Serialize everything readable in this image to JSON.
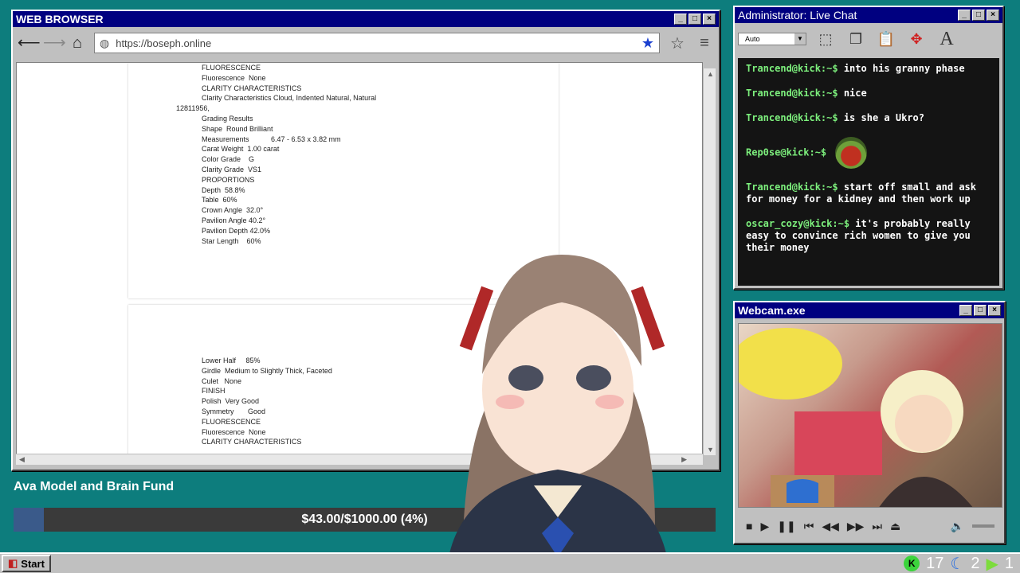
{
  "browser": {
    "title": "WEB BROWSER",
    "url": "https://boseph.online",
    "page1": [
      "FLUORESCENCE",
      "Fluorescence  None",
      "CLARITY CHARACTERISTICS",
      "Clarity Characteristics Cloud, Indented Natural, Natural",
      "12811956,",
      "Grading Results",
      "Shape  Round Brilliant",
      "Measurements           6.47 - 6.53 x 3.82 mm",
      "Carat Weight  1.00 carat",
      "Color Grade    G",
      "Clarity Grade  VS1",
      "PROPORTIONS",
      "Depth  58.8%",
      "Table  60%",
      "Crown Angle  32.0°",
      "Pavilion Angle 40.2°",
      "Pavilion Depth 42.0%",
      "Star Length    60%"
    ],
    "page2": [
      "Lower Half     85%",
      "Girdle  Medium to Slightly Thick, Faceted",
      "Culet   None",
      "FINISH",
      "Polish  Very Good",
      "Symmetry       Good",
      "FLUORESCENCE",
      "Fluorescence  None",
      "CLARITY CHARACTERISTICS"
    ]
  },
  "chat": {
    "title": "Administrator: Live Chat",
    "font_select": "Auto",
    "messages": [
      {
        "user": "Trancend@kick:~$",
        "text": "into his granny phase"
      },
      {
        "user": "Trancend@kick:~$",
        "text": "nice"
      },
      {
        "user": "Trancend@kick:~$",
        "text": "is she a Ukro?"
      },
      {
        "user": "Rep0se@kick:~$",
        "text": ""
      },
      {
        "user": "Trancend@kick:~$",
        "text": "start off small and ask for money for a kidney and then work up"
      },
      {
        "user": "oscar_cozy@kick:~$",
        "text": "it's probably really easy to convince rich women to give you their money"
      }
    ]
  },
  "webcam": {
    "title": "Webcam.exe"
  },
  "fund": {
    "title": "Ava Model and Brain Fund",
    "progress_text": "$43.00/$1000.00 (4%)",
    "raised": 43.0,
    "goal": 1000.0,
    "percent": 4
  },
  "taskbar": {
    "start_label": "Start",
    "tray_counts": [
      "17",
      "2",
      "1"
    ]
  },
  "colors": {
    "accent": "#000080",
    "desktop": "#0d7d7d",
    "chat_user": "#7df07d"
  }
}
